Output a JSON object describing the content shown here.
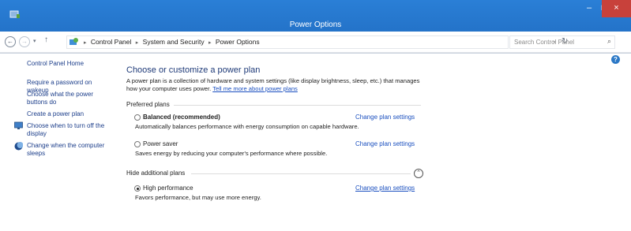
{
  "window": {
    "title": "Power Options",
    "minimize": "–",
    "maximize": "□",
    "close": "×"
  },
  "address": {
    "back": "←",
    "forward": "→",
    "recent": "▾",
    "up": "↑",
    "breadcrumbs": [
      "Control Panel",
      "System and Security",
      "Power Options"
    ],
    "separator": "▸",
    "dropdown": "⌄",
    "refresh": "↻",
    "search_placeholder": "Search Control Panel",
    "search_icon": "⌕"
  },
  "sidebar": {
    "home": "Control Panel Home",
    "items": [
      {
        "label": "Require a password on wakeup"
      },
      {
        "label": "Choose what the power buttons do"
      },
      {
        "label": "Create a power plan"
      },
      {
        "label": "Choose when to turn off the display",
        "icon": "monitor-icon"
      },
      {
        "label": "Change when the computer sleeps",
        "icon": "moon-icon"
      }
    ]
  },
  "main": {
    "heading": "Choose or customize a power plan",
    "description": "A power plan is a collection of hardware and system settings (like display brightness, sleep, etc.) that manages how your computer uses power.",
    "learn_link": "Tell me more about power plans",
    "preferred_label": "Preferred plans",
    "hidden_label": "Hide additional plans",
    "expander": "⌃",
    "change_label": "Change plan settings",
    "plans": [
      {
        "name": "Balanced (recommended)",
        "desc": "Automatically balances performance with energy consumption on capable hardware.",
        "selected": false
      },
      {
        "name": "Power saver",
        "desc": "Saves energy by reducing your computer's performance where possible.",
        "selected": false
      },
      {
        "name": "High performance",
        "desc": "Favors performance, but may use more energy.",
        "selected": true
      }
    ]
  },
  "help": "?"
}
